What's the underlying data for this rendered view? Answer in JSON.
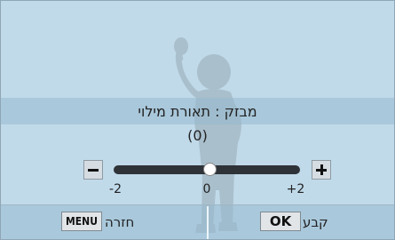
{
  "screen": {
    "background_color": "#c0daea"
  },
  "setting": {
    "title": "מבזק : תאורת מילוי",
    "value_display": "(0)"
  },
  "slider": {
    "min": -2,
    "max": 2,
    "value": 0,
    "minus_icon": "minus-icon",
    "plus_icon": "plus-icon",
    "ticks": [
      {
        "label": "-2"
      },
      {
        "label": "0"
      },
      {
        "label": "+2"
      }
    ]
  },
  "bottom_bar": {
    "back_key": "MENU",
    "back_label": "חזרה",
    "confirm_key": "OK",
    "confirm_label": "קבע"
  }
}
